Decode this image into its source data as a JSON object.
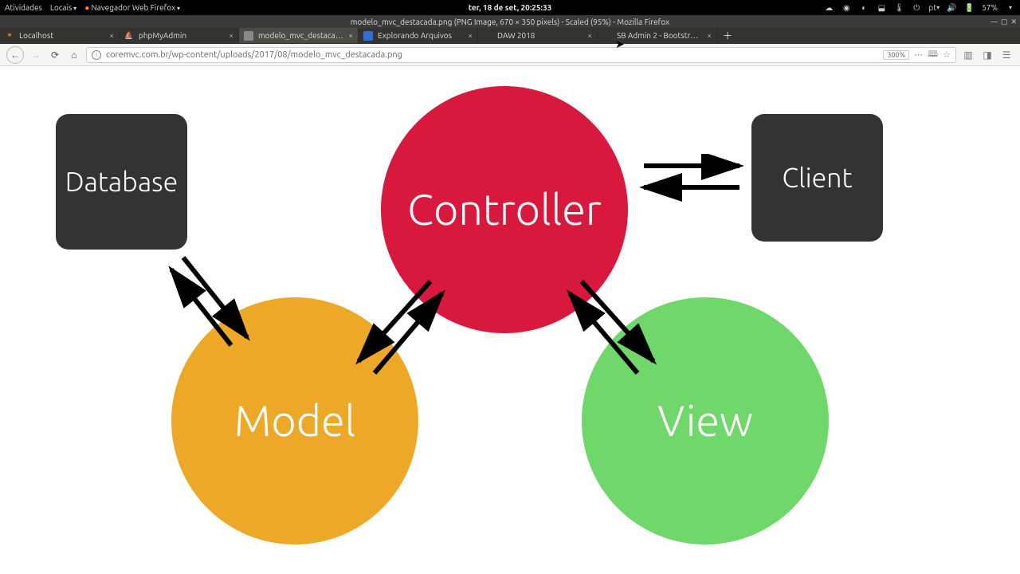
{
  "gnome": {
    "activities": "Atividades",
    "places": "Locais",
    "app_menu": "Navegador Web Firefox",
    "clock": "ter, 18 de set, 20:25:33",
    "lang": "pt",
    "battery": "57%"
  },
  "window": {
    "title": "modelo_mvc_destacada.png (PNG Image, 670 × 350 pixels) - Scaled (95%) - Mozilla Firefox"
  },
  "tabs": [
    {
      "label": "Localhost"
    },
    {
      "label": "phpMyAdmin"
    },
    {
      "label": "modelo_mvc_destacada"
    },
    {
      "label": "Explorando Arquivos"
    },
    {
      "label": "DAW 2018"
    },
    {
      "label": "SB Admin 2 - Bootstrap Ad…"
    }
  ],
  "nav": {
    "url": "coremvc.com.br/wp-content/uploads/2017/08/modelo_mvc_destacada.png",
    "zoom": "300%"
  },
  "diagram": {
    "database": "Database",
    "controller": "Controller",
    "client": "Client",
    "model": "Model",
    "view": "View"
  }
}
